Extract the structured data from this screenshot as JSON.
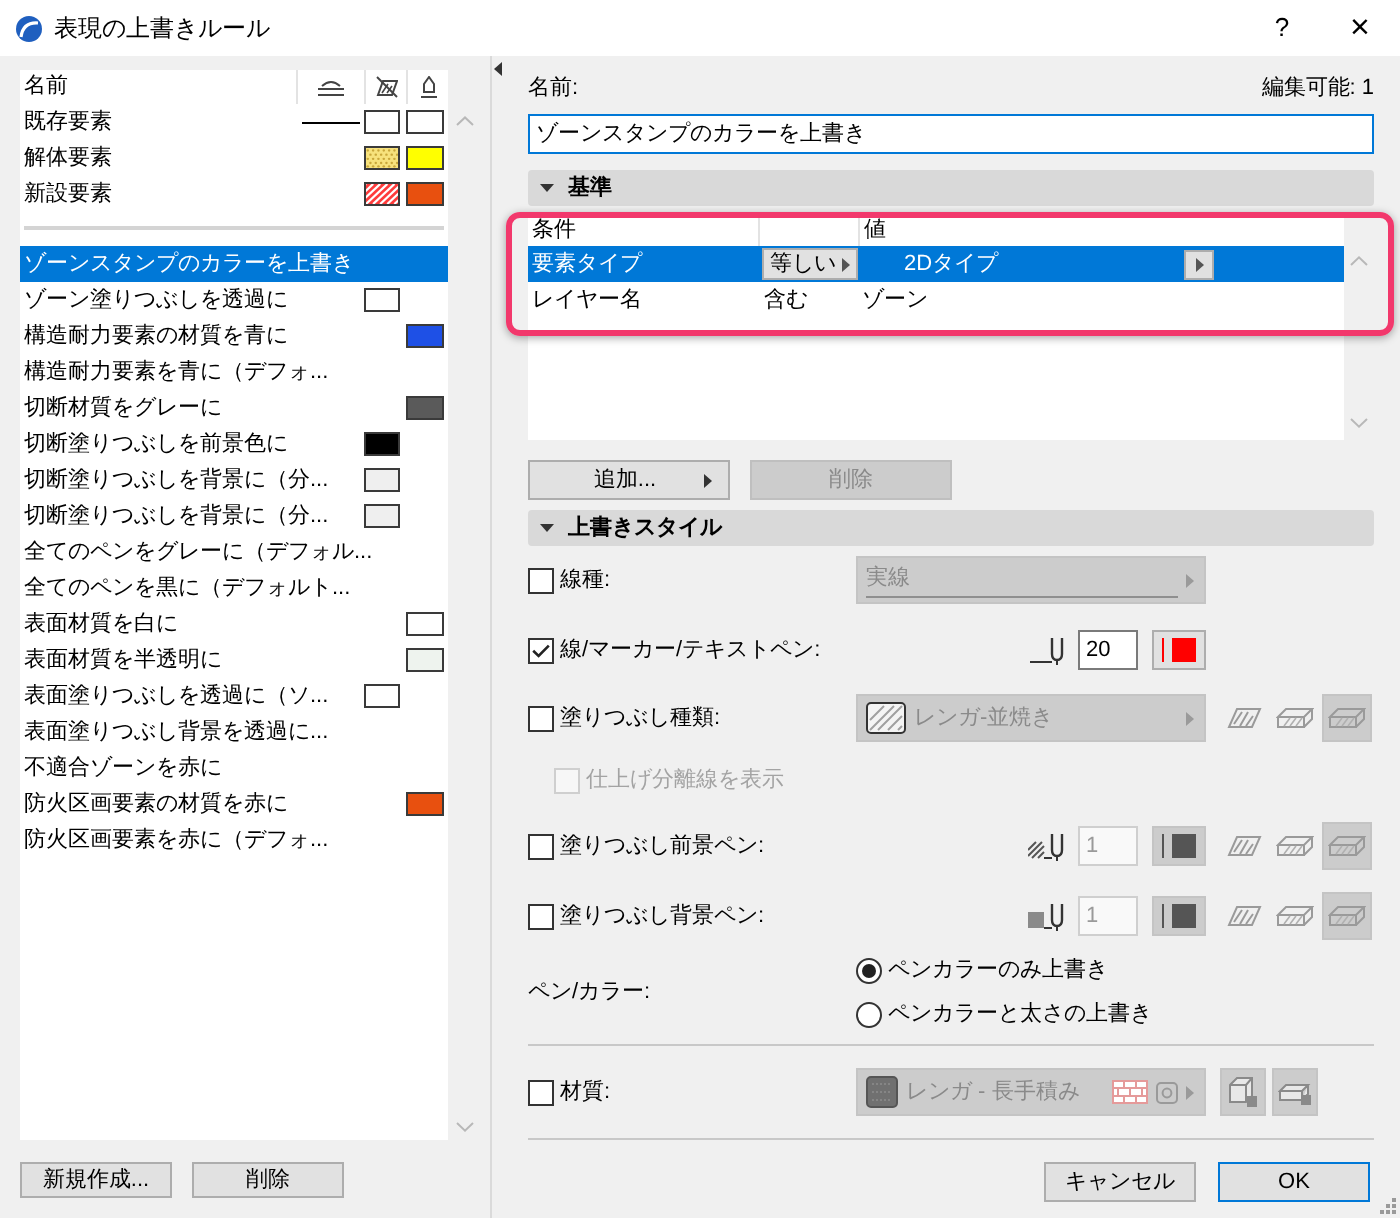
{
  "window": {
    "title": "表現の上書きルール",
    "help_button": "?",
    "close_button": "×"
  },
  "rule_list": {
    "name_heading": "名前",
    "presets": [
      {
        "name": "既存要素",
        "selected": false,
        "line": true,
        "fill": {
          "color": "#ffffff",
          "kind": "plain"
        },
        "material": {
          "color": "#ffffff"
        }
      },
      {
        "name": "解体要素",
        "selected": false,
        "line": false,
        "fill": {
          "color": "#f7e27c",
          "kind": "dots"
        },
        "material": {
          "color": "#ffff00"
        }
      },
      {
        "name": "新設要素",
        "selected": false,
        "line": false,
        "fill": {
          "color": "#ff3b3b",
          "kind": "hatch"
        },
        "material": {
          "color": "#e8500f"
        }
      }
    ],
    "rules": [
      {
        "name": "ゾーンスタンプのカラーを上書き",
        "selected": true
      },
      {
        "name": "ゾーン塗りつぶしを透過に",
        "selected": false,
        "fill": {
          "color": "#ffffff"
        }
      },
      {
        "name": "構造耐力要素の材質を青に",
        "selected": false,
        "material": {
          "color": "#1e50e6"
        }
      },
      {
        "name": "構造耐力要素を青に（デフォ...",
        "selected": false
      },
      {
        "name": "切断材質をグレーに",
        "selected": false,
        "material": {
          "color": "#5a5a5a"
        }
      },
      {
        "name": "切断塗りつぶしを前景色に",
        "selected": false,
        "fill": {
          "color": "#000000"
        }
      },
      {
        "name": "切断塗りつぶしを背景に（分...",
        "selected": false,
        "fill": {
          "color": "#efefef"
        }
      },
      {
        "name": "切断塗りつぶしを背景に（分...",
        "selected": false,
        "fill": {
          "color": "#efefef"
        }
      },
      {
        "name": "全てのペンをグレーに（デフォル...",
        "selected": false
      },
      {
        "name": "全てのペンを黒に（デフォルト...",
        "selected": false
      },
      {
        "name": "表面材質を白に",
        "selected": false,
        "material": {
          "color": "#ffffff"
        }
      },
      {
        "name": "表面材質を半透明に",
        "selected": false,
        "material": {
          "color": "#eef3ee"
        }
      },
      {
        "name": "表面塗りつぶしを透過に（ソ...",
        "selected": false,
        "fill": {
          "color": "#ffffff"
        }
      },
      {
        "name": "表面塗りつぶし背景を透過に...",
        "selected": false
      },
      {
        "name": "不適合ゾーンを赤に",
        "selected": false
      },
      {
        "name": "防火区画要素の材質を赤に",
        "selected": false,
        "material": {
          "color": "#e8500f"
        }
      },
      {
        "name": "防火区画要素を赤に（デフォ...",
        "selected": false
      }
    ],
    "buttons": [
      {
        "label": "新規作成..."
      },
      {
        "label": "削除"
      }
    ]
  },
  "editor": {
    "name_label": "名前:",
    "edit_status": "編集可能: 1",
    "name_value": "ゾーンスタンプのカラーを上書き",
    "criteria": {
      "title": "基準",
      "expanded": true,
      "highlighted": true,
      "condition_heading": "条件",
      "value_heading": "値",
      "rows": [
        {
          "parameter": "要素タイプ",
          "operator": "等しい",
          "value": "2Dタイプ",
          "selected": true
        },
        {
          "parameter": "レイヤー名",
          "operator": "含む",
          "value": "ゾーン",
          "selected": false
        }
      ],
      "buttons": [
        {
          "label": "追加...",
          "menu": true,
          "disabled": false
        },
        {
          "label": "削除",
          "menu": false,
          "disabled": true
        }
      ]
    },
    "style": {
      "title": "上書きスタイル",
      "expanded": true,
      "rows": [
        {
          "kind": "linetype",
          "label": "線種:",
          "checked": false,
          "value": "実線"
        },
        {
          "kind": "pen",
          "label": "線/マーカー/テキストペン:",
          "checked": true,
          "pen": "20",
          "color": "#ff0000"
        },
        {
          "kind": "fill",
          "label": "塗りつぶし種類:",
          "checked": false,
          "value": "レンガ-並焼き"
        },
        {
          "kind": "option",
          "label": "仕上げ分離線を表示",
          "checked": false,
          "disabled": true
        },
        {
          "kind": "foreground",
          "label": "塗りつぶし前景ペン:",
          "checked": false,
          "pen": "1",
          "color": "#555555"
        },
        {
          "kind": "background",
          "label": "塗りつぶし背景ペン:",
          "checked": false,
          "pen": "1",
          "color": "#555555"
        },
        {
          "kind": "radio",
          "label": "ペン/カラー:",
          "options": [
            {
              "label": "ペンカラーのみ上書き",
              "selected": true
            },
            {
              "label": "ペンカラーと太さの上書き",
              "selected": false
            }
          ]
        },
        {
          "kind": "material",
          "label": "材質:",
          "checked": false,
          "value": "レンガ - 長手積み"
        }
      ]
    },
    "buttons": [
      {
        "label": "キャンセル",
        "default": false
      },
      {
        "label": "OK",
        "default": true
      }
    ]
  }
}
